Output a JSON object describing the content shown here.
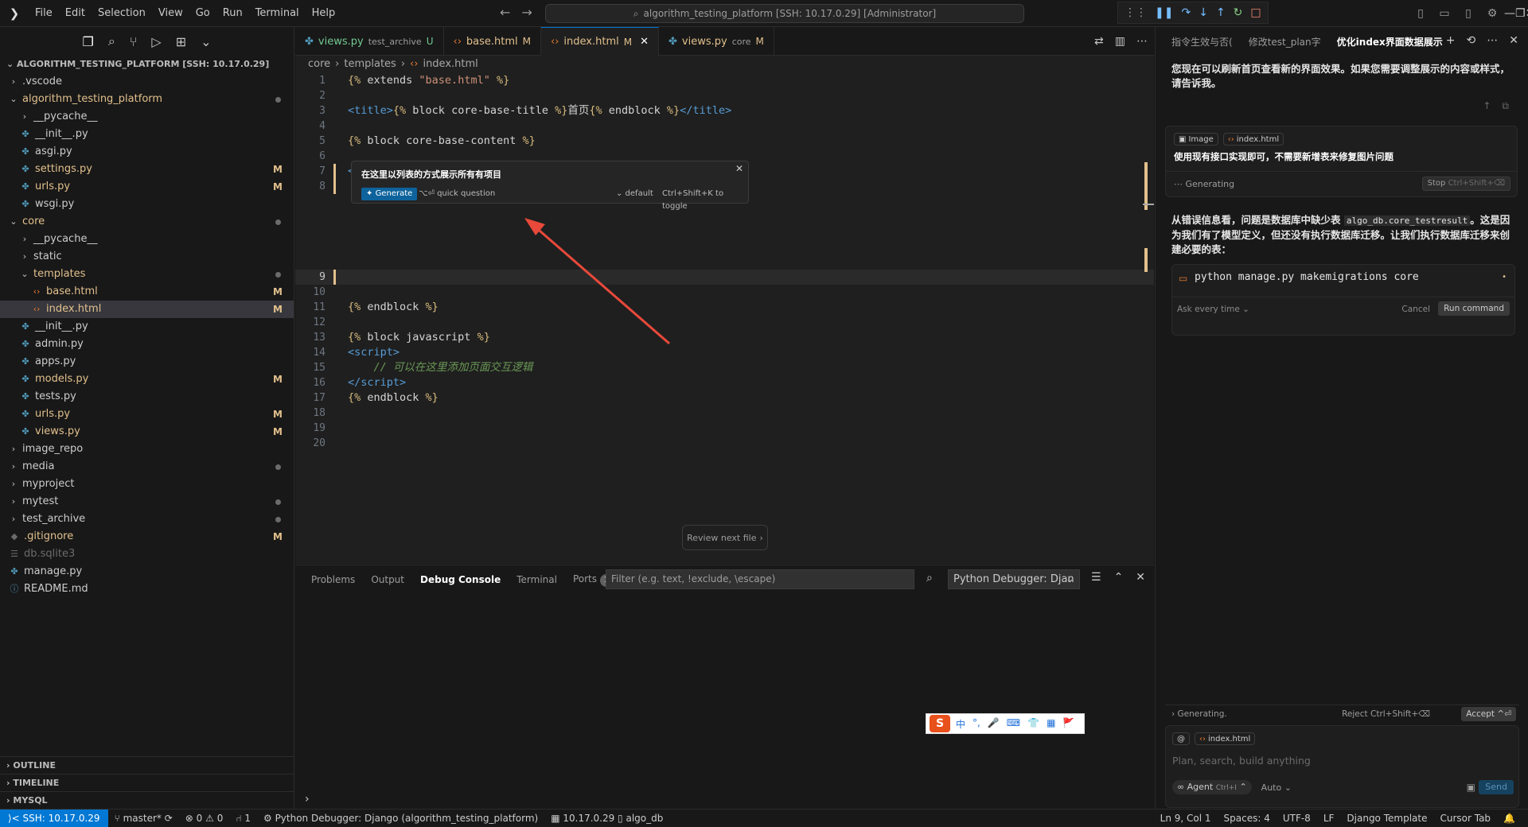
{
  "menu": [
    "File",
    "Edit",
    "Selection",
    "View",
    "Go",
    "Run",
    "Terminal",
    "Help"
  ],
  "command_center": "algorithm_testing_platform [SSH: 10.17.0.29] [Administrator]",
  "explorer": {
    "root": "ALGORITHM_TESTING_PLATFORM [SSH: 10.17.0.29]",
    "items": [
      {
        "name": ".vscode",
        "type": "folder",
        "open": false,
        "indent": 1,
        "status": ""
      },
      {
        "name": "algorithm_testing_platform",
        "type": "folder",
        "open": true,
        "indent": 1,
        "status": "dot",
        "color": "mod"
      },
      {
        "name": "__pycache__",
        "type": "folder",
        "open": false,
        "indent": 2,
        "status": ""
      },
      {
        "name": "__init__.py",
        "type": "py",
        "indent": 2,
        "status": ""
      },
      {
        "name": "asgi.py",
        "type": "py",
        "indent": 2,
        "status": ""
      },
      {
        "name": "settings.py",
        "type": "py",
        "indent": 2,
        "status": "M",
        "color": "mod"
      },
      {
        "name": "urls.py",
        "type": "py",
        "indent": 2,
        "status": "M",
        "color": "mod"
      },
      {
        "name": "wsgi.py",
        "type": "py",
        "indent": 2,
        "status": ""
      },
      {
        "name": "core",
        "type": "folder",
        "open": true,
        "indent": 1,
        "status": "dot",
        "color": "mod"
      },
      {
        "name": "__pycache__",
        "type": "folder",
        "open": false,
        "indent": 2,
        "status": ""
      },
      {
        "name": "static",
        "type": "folder",
        "open": false,
        "indent": 2,
        "status": ""
      },
      {
        "name": "templates",
        "type": "folder",
        "open": true,
        "indent": 2,
        "status": "dot",
        "color": "mod"
      },
      {
        "name": "base.html",
        "type": "html",
        "indent": 3,
        "status": "M",
        "color": "mod"
      },
      {
        "name": "index.html",
        "type": "html",
        "indent": 3,
        "status": "M",
        "color": "mod",
        "selected": true
      },
      {
        "name": "__init__.py",
        "type": "py",
        "indent": 2,
        "status": ""
      },
      {
        "name": "admin.py",
        "type": "py",
        "indent": 2,
        "status": ""
      },
      {
        "name": "apps.py",
        "type": "py",
        "indent": 2,
        "status": ""
      },
      {
        "name": "models.py",
        "type": "py",
        "indent": 2,
        "status": "M",
        "color": "mod"
      },
      {
        "name": "tests.py",
        "type": "py",
        "indent": 2,
        "status": ""
      },
      {
        "name": "urls.py",
        "type": "py",
        "indent": 2,
        "status": "M",
        "color": "mod"
      },
      {
        "name": "views.py",
        "type": "py",
        "indent": 2,
        "status": "M",
        "color": "mod"
      },
      {
        "name": "image_repo",
        "type": "folder",
        "open": false,
        "indent": 1,
        "status": ""
      },
      {
        "name": "media",
        "type": "folder",
        "open": false,
        "indent": 1,
        "status": "dot"
      },
      {
        "name": "myproject",
        "type": "folder",
        "open": false,
        "indent": 1,
        "status": ""
      },
      {
        "name": "mytest",
        "type": "folder",
        "open": false,
        "indent": 1,
        "status": "dot"
      },
      {
        "name": "test_archive",
        "type": "folder",
        "open": false,
        "indent": 1,
        "status": "dot"
      },
      {
        "name": ".gitignore",
        "type": "git",
        "indent": 1,
        "status": "M",
        "color": "mod"
      },
      {
        "name": "db.sqlite3",
        "type": "db",
        "indent": 1,
        "status": "",
        "color": "ignored"
      },
      {
        "name": "manage.py",
        "type": "py",
        "indent": 1,
        "status": ""
      },
      {
        "name": "README.md",
        "type": "info",
        "indent": 1,
        "status": ""
      }
    ],
    "bottom_sections": [
      "OUTLINE",
      "TIMELINE",
      "MYSQL"
    ]
  },
  "tabs": [
    {
      "name": "views.py",
      "desc": "test_archive",
      "state": "U",
      "icon": "py"
    },
    {
      "name": "base.html",
      "desc": "",
      "state": "M",
      "icon": "html"
    },
    {
      "name": "index.html",
      "desc": "",
      "state": "M",
      "icon": "html",
      "active": true
    },
    {
      "name": "views.py",
      "desc": "core",
      "state": "M",
      "icon": "py"
    }
  ],
  "breadcrumb": [
    "core",
    "templates",
    "index.html"
  ],
  "code_lines": [
    {
      "n": "1",
      "html": "<span class='t-tpl'>{%</span> extends <span class='t-str'>\"base.html\"</span> <span class='t-tpl'>%}</span>"
    },
    {
      "n": "2",
      "html": ""
    },
    {
      "n": "3",
      "html": "<span class='t-tag'>&lt;title&gt;</span><span class='t-tpl'>{%</span> block core-base-title <span class='t-tpl'>%}</span>首页<span class='t-tpl'>{%</span> endblock <span class='t-tpl'>%}</span><span class='t-tag'>&lt;/title&gt;</span>"
    },
    {
      "n": "4",
      "html": ""
    },
    {
      "n": "5",
      "html": "<span class='t-tpl'>{%</span> block core-base-content <span class='t-tpl'>%}</span>"
    },
    {
      "n": "6",
      "html": ""
    },
    {
      "n": "7",
      "html": "<span class='t-tag'>&lt;h1</span> <span class='t-attr'>align</span>=<span class='t-str'>\"center\"</span><span class='t-tag'>&gt;</span>欢迎来到算法测试平台! <span class='t-tag'>&lt;/h1&gt;</span>",
      "mod": true
    },
    {
      "n": "8",
      "html": "",
      "mod": true
    },
    {
      "n": "",
      "html": ""
    },
    {
      "n": "",
      "html": ""
    },
    {
      "n": "",
      "html": ""
    },
    {
      "n": "",
      "html": ""
    },
    {
      "n": "",
      "html": ""
    },
    {
      "n": "9",
      "html": "",
      "cur": true,
      "mod": true
    },
    {
      "n": "10",
      "html": ""
    },
    {
      "n": "11",
      "html": "<span class='t-tpl'>{%</span> endblock <span class='t-tpl'>%}</span>"
    },
    {
      "n": "12",
      "html": ""
    },
    {
      "n": "13",
      "html": "<span class='t-tpl'>{%</span> block javascript <span class='t-tpl'>%}</span>"
    },
    {
      "n": "14",
      "html": "<span class='t-tag'>&lt;script&gt;</span>"
    },
    {
      "n": "15",
      "html": "    <span class='t-cmt'>// 可以在这里添加页面交互逻辑</span>"
    },
    {
      "n": "16",
      "html": "<span class='t-tag'>&lt;/script&gt;</span>"
    },
    {
      "n": "17",
      "html": "<span class='t-tpl'>{%</span> endblock <span class='t-tpl'>%}</span>"
    },
    {
      "n": "18",
      "html": ""
    },
    {
      "n": "19",
      "html": ""
    },
    {
      "n": "20",
      "html": ""
    }
  ],
  "inline_prompt": {
    "text": "在这里以列表的方式展示所有有项目",
    "generate": "Generate",
    "quick_question": "⌥⏎ quick question",
    "model": "⌄ default",
    "toggle_hint": "Ctrl+Shift+K to toggle"
  },
  "review_next": "Review next file",
  "panel": {
    "tabs": [
      "Problems",
      "Output",
      "Debug Console",
      "Terminal",
      "Ports"
    ],
    "active": "Debug Console",
    "ports_count": "1",
    "filter_placeholder": "Filter (e.g. text, !exclude, \\escape)",
    "debugger": "Python Debugger: Djan"
  },
  "ime": {
    "s": "S",
    "items": [
      "中",
      "°,",
      "🎤",
      "⌨",
      "👕",
      "▦",
      "🚩"
    ]
  },
  "chat": {
    "tabs": [
      "指令生效与否(",
      "修改test_plan字",
      "优化index界面数据展示"
    ],
    "active_tab": "优化index界面数据展示",
    "msg1": "您现在可以刷新首页查看新的界面效果。如果您需要调整展示的内容或样式，请告诉我。",
    "card": {
      "chip_image": "Image",
      "chip_file": "index.html",
      "text": "使用现有接口实现即可，不需要新增表来修复图片问题",
      "generating": "Generating",
      "stop": "Stop",
      "stop_hint": "Ctrl+Shift+⌫"
    },
    "msg2_a": "从错误信息看，问题是数据库中缺少表",
    "msg2_code": "algo_db.core_testresult",
    "msg2_b": "。这是因为我们有了模型定义，但还没有执行数据库迁移。让我们执行数据库迁移来创建必要的表：",
    "command": "python manage.py makemigrations core",
    "ask": "Ask every time ⌄",
    "cancel": "Cancel",
    "run": "Run command",
    "gen_bar": "Generating.",
    "reject": "Reject Ctrl+Shift+⌫",
    "accept": "Accept ^⏎",
    "input_chip": "index.html",
    "input_placeholder": "Plan, search, build anything",
    "agent": "∞ Agent",
    "agent_hint": "Ctrl+I",
    "auto": "Auto ⌄",
    "send": "Send"
  },
  "statusbar": {
    "remote": "⟩< SSH: 10.17.0.29",
    "branch": "master*",
    "sync": "⟳",
    "problems": "⊗ 0 ⚠ 0",
    "ports": "⑁ 1",
    "debug": "Python Debugger: Django (algorithm_testing_platform)",
    "db": "▦ 10.17.0.29 ▯ algo_db",
    "position": "Ln 9, Col 1",
    "spaces": "Spaces: 4",
    "encoding": "UTF-8",
    "eol": "LF",
    "language": "Django Template",
    "cursor_tab": "Cursor Tab"
  }
}
